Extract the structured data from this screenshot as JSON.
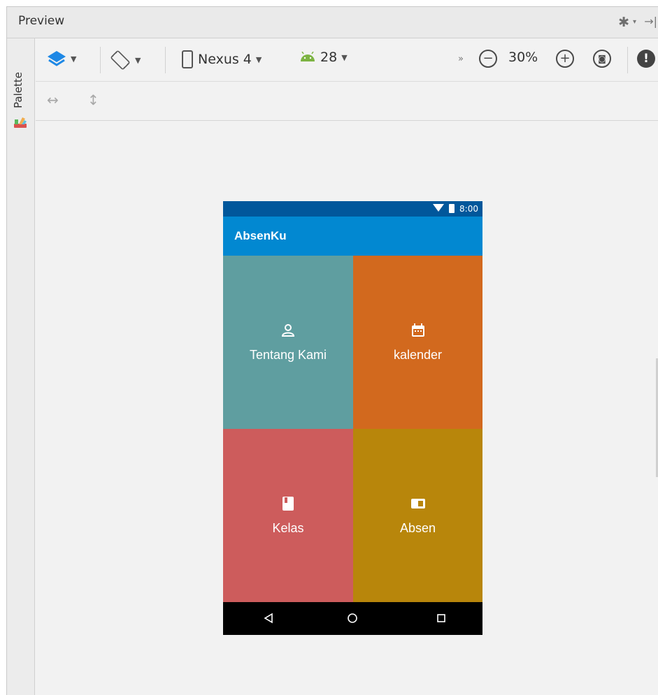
{
  "panel": {
    "title": "Preview"
  },
  "palette": {
    "label": "Palette"
  },
  "toolbar": {
    "device": "Nexus 4",
    "api_level": "28",
    "overflow_glyph": "»",
    "zoom_level": "30%"
  },
  "phone": {
    "status_time": "8:00",
    "app_title": "AbsenKu",
    "tiles": [
      {
        "label": "Tentang Kami",
        "icon": "person-icon",
        "color": "#5f9ea0"
      },
      {
        "label": "kalender",
        "icon": "calendar-icon",
        "color": "#d2691e"
      },
      {
        "label": "Kelas",
        "icon": "book-icon",
        "color": "#cd5c5c"
      },
      {
        "label": "Absen",
        "icon": "card-icon",
        "color": "#b8860b"
      }
    ],
    "colors": {
      "status_bar": "#01579b",
      "app_bar": "#0288d1",
      "nav_bar": "#000000"
    }
  }
}
